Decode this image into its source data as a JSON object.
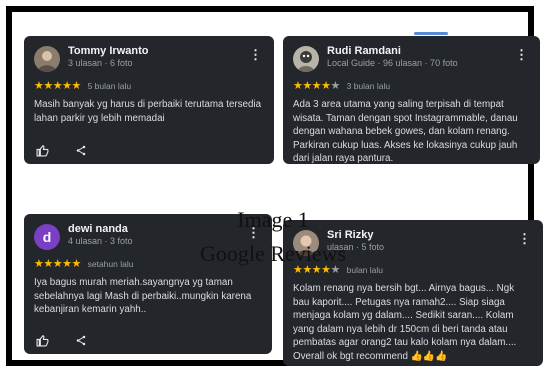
{
  "reviews": [
    {
      "name": "Tommy Irwanto",
      "meta": "3 ulasan · 6 foto",
      "rating": 5,
      "time": "5 bulan lalu",
      "text": "Masih banyak yg harus di perbaiki terutama tersedia lahan parkir yg lebih memadai",
      "avatar_icon": "person-photo-icon"
    },
    {
      "name": "Rudi Ramdani",
      "meta": "Local Guide · 96 ulasan · 70 foto",
      "rating": 4,
      "time": "3 bulan lalu",
      "text": "Ada 3 area utama yang saling terpisah di tempat wisata. Taman dengan spot Instagrammable, danau dengan wahana bebek gowes, dan kolam renang. Parkiran cukup luas. Akses ke lokasinya cukup jauh dari jalan raya pantura.",
      "avatar_icon": "person-photo-icon"
    },
    {
      "name": "dewi nanda",
      "meta": "4 ulasan · 3 foto",
      "rating": 5,
      "time": "setahun lalu",
      "text": "Iya bagus murah meriah.sayangnya yg taman sebelahnya lagi Mash di perbaiki..mungkin karena kebanjiran kemarin yahh..",
      "avatar_letter": "d",
      "avatar_color": "#7b3fc4"
    },
    {
      "name": "Sri Rizky",
      "meta": "ulasan · 5 foto",
      "rating": 4,
      "time": "bulan lalu",
      "text": "Kolam renang nya bersih bgt... Airnya bagus... Ngk bau kaporit.... Petugas nya ramah2.... Siap siaga menjaga kolam yg dalam.... Sedikit saran.... Kolam yang dalam nya lebih dr 150cm di beri tanda atau pembatas agar orang2 tau kalo kolam nya dalam.... Overall ok bgt recommend 👍👍👍",
      "avatar_icon": "person-photo-icon"
    }
  ],
  "overlay": {
    "line1": "Image 1",
    "line2": "Google Reviews"
  },
  "colors": {
    "card_bg": "#23262b",
    "star": "#fbbc04",
    "muted": "#9aa0a6"
  }
}
